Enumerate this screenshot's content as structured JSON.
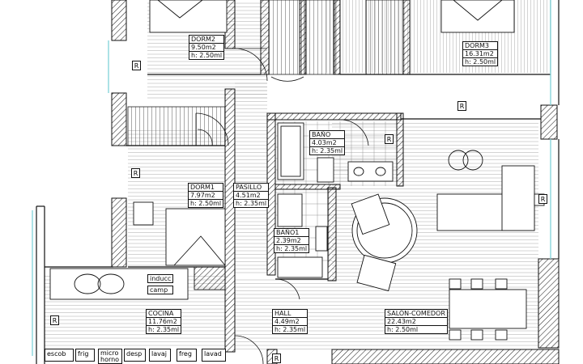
{
  "rooms": {
    "dorm2": {
      "name": "DORM2",
      "area": "9.50m2",
      "height": "h: 2.50ml"
    },
    "dorm3": {
      "name": "DORM3",
      "area": "16.31m2",
      "height": "h: 2.50ml"
    },
    "bano": {
      "name": "BAÑO",
      "area": "4.03m2",
      "height": "h: 2.35ml"
    },
    "dorm1": {
      "name": "DORM1",
      "area": "7.97m2",
      "height": "h: 2.50ml"
    },
    "pasillo": {
      "name": "PASILLO",
      "area": "4.51m2",
      "height": "h: 2.35ml"
    },
    "bano1": {
      "name": "BAÑO1",
      "area": "2.39m2",
      "height": "h: 2.35ml"
    },
    "cocina": {
      "name": "COCINA",
      "area": "11.76m2",
      "height": "h: 2.35ml"
    },
    "hall": {
      "name": "HALL",
      "area": "4.49m2",
      "height": "h: 2.35ml"
    },
    "salon": {
      "name": "SALÓN-COMEDOR",
      "area": "22.43m2",
      "height": "h: 2.50ml"
    }
  },
  "kitchen_appliances": {
    "hob": "inducc",
    "hood": "camp"
  },
  "kitchen_units": [
    "escob",
    "frig",
    "micro",
    "desp",
    "lavaj",
    "freg",
    "lavad"
  ],
  "kitchen_unit_sub": {
    "micro": "horno"
  },
  "marker": "R",
  "colors": {
    "line": "#111111",
    "wall_hatch": "#222222",
    "floor": "#9a9a9a",
    "window": "#7fd3d9"
  }
}
